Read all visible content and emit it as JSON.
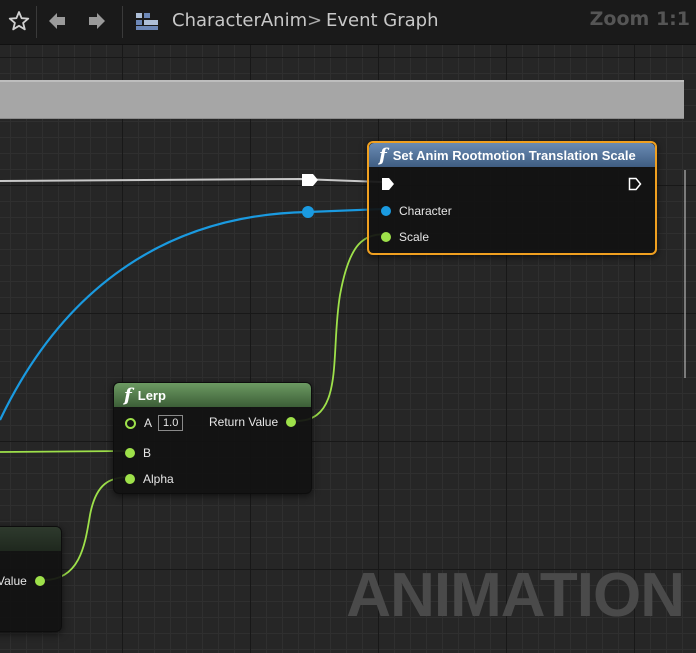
{
  "toolbar": {
    "favorite_icon": "star-icon",
    "back_icon": "arrow-left-icon",
    "forward_icon": "arrow-right-icon",
    "graph_icon": "blueprint-grid-icon",
    "breadcrumb_root": "CharacterAnim",
    "breadcrumb_separator": ">",
    "breadcrumb_current": "Event Graph",
    "zoom": "Zoom 1:1"
  },
  "nodes": {
    "set_scale": {
      "title": "Set Anim Rootmotion Translation Scale",
      "pin_character": "Character",
      "pin_scale": "Scale"
    },
    "lerp": {
      "title": "Lerp",
      "pin_a": "A",
      "pin_a_value": "1.0",
      "pin_b": "B",
      "pin_alpha": "Alpha",
      "pin_return": "Return Value"
    },
    "partial": {
      "pin_value": "Value"
    }
  },
  "watermark": "ANIMATION",
  "colors": {
    "exec": "#ffffff",
    "object_pin": "#1a9ae0",
    "float_pin": "#9ee14a",
    "function_header": "#4c6e95",
    "lerp_header": "#5a8a52",
    "selection": "#f0a020"
  }
}
